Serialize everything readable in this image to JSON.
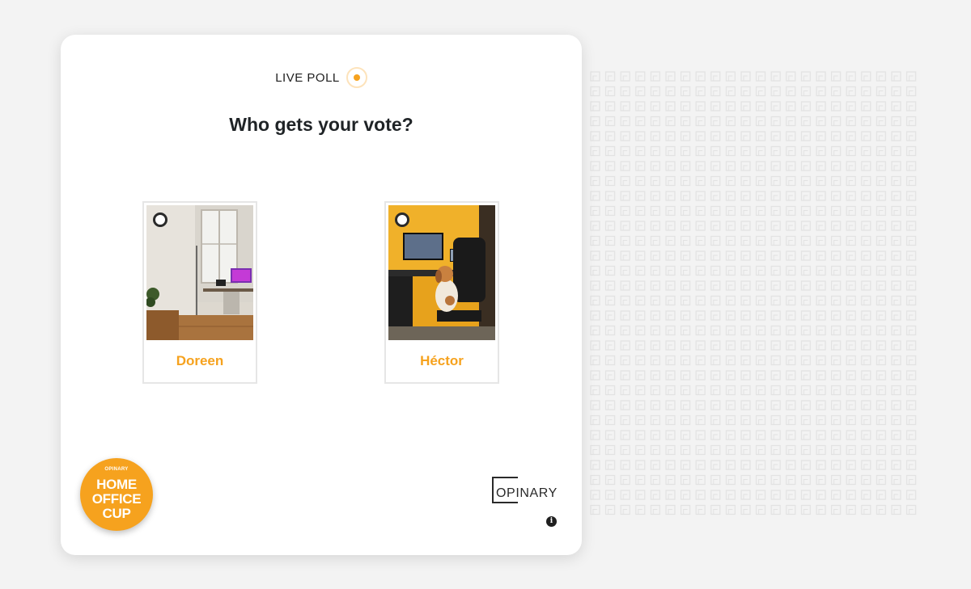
{
  "poll": {
    "live_label": "LIVE POLL",
    "question": "Who gets your vote?",
    "options": [
      {
        "name": "Doreen",
        "image": "home-office-photo-window-desk"
      },
      {
        "name": "Héctor",
        "image": "home-office-photo-dog-on-chair"
      }
    ]
  },
  "badge": {
    "mini": "OPINARY",
    "line1": "HOME",
    "line2": "OFFICE",
    "line3": "CUP"
  },
  "brand": {
    "name": "OPINARY"
  },
  "info": {
    "icon": "info-icon",
    "glyph": "i"
  },
  "colors": {
    "accent": "#f6a21e",
    "background": "#f3f3f3",
    "card": "#ffffff",
    "text": "#1f2326"
  }
}
